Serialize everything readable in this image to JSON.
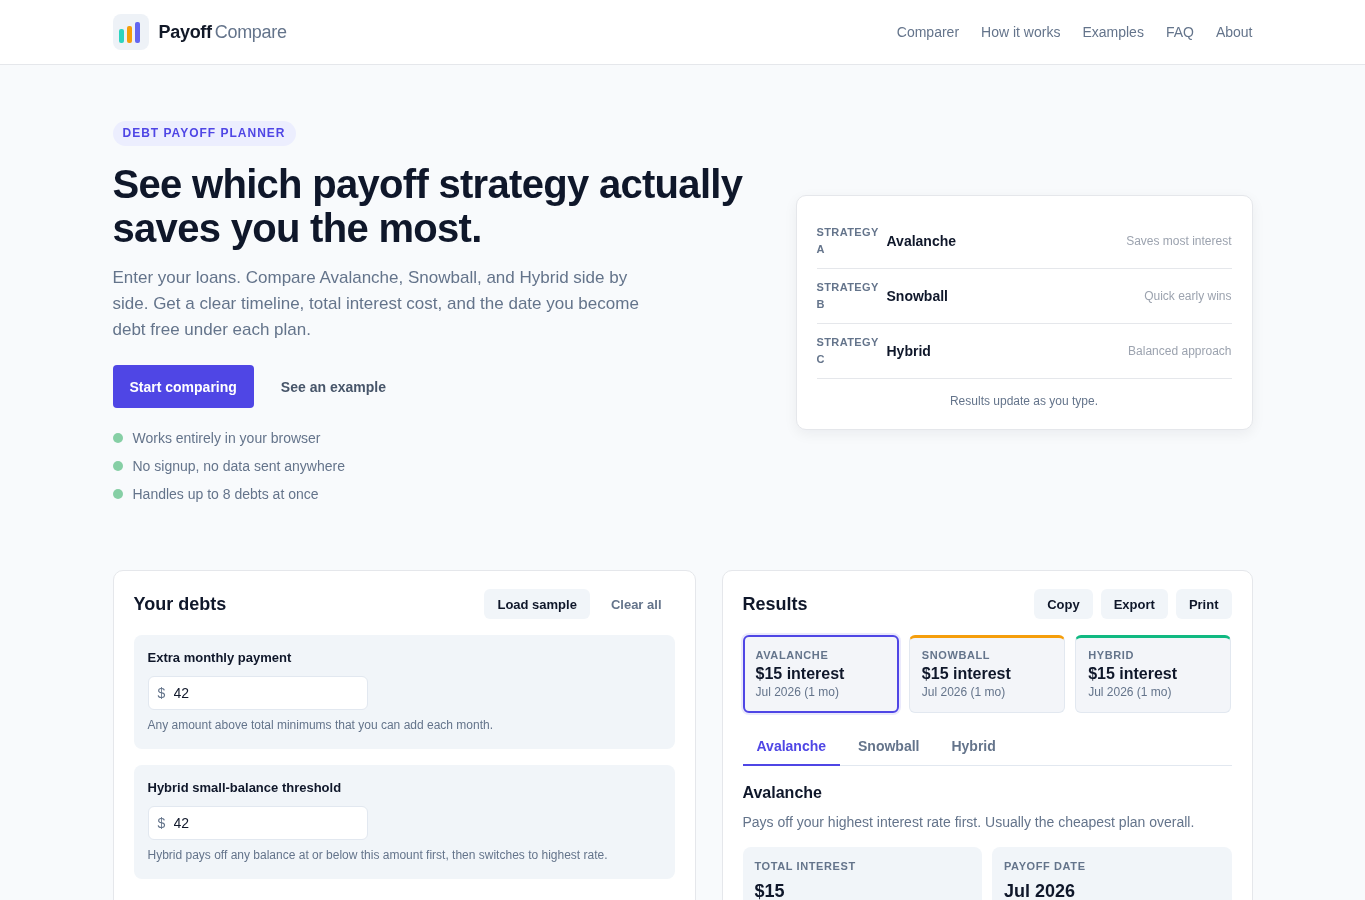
{
  "header": {
    "brand": {
      "name": "Payoff",
      "suffix": "Compare"
    },
    "nav": [
      "Comparer",
      "How it works",
      "Examples",
      "FAQ",
      "About"
    ]
  },
  "hero": {
    "badge": "DEBT PAYOFF PLANNER",
    "title": "See which payoff strategy actually saves you the most.",
    "intro": "Enter your loans. Compare Avalanche, Snowball, and Hybrid side by side. Get a clear timeline, total interest cost, and the date you become debt free under each plan.",
    "actions": [
      {
        "label": "Start comparing",
        "kind": "primary"
      },
      {
        "label": "See an example",
        "kind": "link"
      }
    ],
    "features": [
      "Works entirely in your browser",
      "No signup, no data sent anywhere",
      "Handles up to 8 debts at once"
    ]
  },
  "strategy_card": {
    "rows": [
      {
        "tag": "STRATEGY A",
        "name": "Avalanche",
        "note": "Saves most interest"
      },
      {
        "tag": "STRATEGY B",
        "name": "Snowball",
        "note": "Quick early wins"
      },
      {
        "tag": "STRATEGY C",
        "name": "Hybrid",
        "note": "Balanced approach"
      }
    ],
    "footer": "Results update as you type."
  },
  "debts_panel": {
    "title": "Your debts",
    "actions": [
      {
        "label": "Load sample",
        "kind": "filled"
      },
      {
        "label": "Clear all",
        "kind": "plain"
      }
    ],
    "settings": [
      {
        "label": "Extra monthly payment",
        "prefix": "$",
        "value": "42",
        "hint": "Any amount above total minimums that you can add each month."
      },
      {
        "label": "Hybrid small-balance threshold",
        "prefix": "$",
        "value": "42",
        "hint": "Hybrid pays off any balance at or below this amount first, then switches to highest rate."
      }
    ]
  },
  "results_panel": {
    "title": "Results",
    "actions": [
      "Copy",
      "Export",
      "Print"
    ],
    "summaries": [
      {
        "name": "AVALANCHE",
        "interest": "$15 interest",
        "date": "Jul 2026 (1 mo)",
        "color": "#4f46e5",
        "selected": true
      },
      {
        "name": "SNOWBALL",
        "interest": "$15 interest",
        "date": "Jul 2026 (1 mo)",
        "color": "#f59e0b",
        "selected": false
      },
      {
        "name": "HYBRID",
        "interest": "$15 interest",
        "date": "Jul 2026 (1 mo)",
        "color": "#10b981",
        "selected": false
      }
    ],
    "tabs": [
      {
        "label": "Avalanche",
        "selected": true
      },
      {
        "label": "Snowball",
        "selected": false
      },
      {
        "label": "Hybrid",
        "selected": false
      }
    ],
    "detail": {
      "title": "Avalanche",
      "description": "Pays off your highest interest rate first. Usually the cheapest plan overall.",
      "stats": [
        {
          "label": "TOTAL INTEREST",
          "value": "$15"
        },
        {
          "label": "PAYOFF DATE",
          "value": "Jul 2026"
        }
      ]
    }
  }
}
